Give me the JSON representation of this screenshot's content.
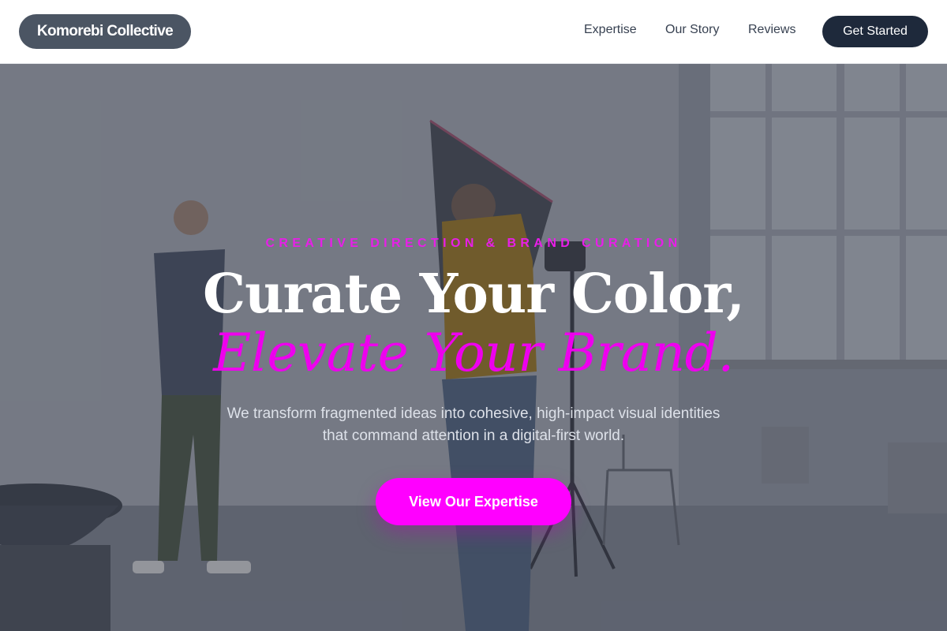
{
  "header": {
    "logo_text": "Komorebi Collective",
    "nav": [
      {
        "label": "Expertise"
      },
      {
        "label": "Our Story"
      },
      {
        "label": "Reviews"
      }
    ],
    "cta_label": "Get Started"
  },
  "hero": {
    "eyebrow": "CREATIVE DIRECTION & BRAND CURATION",
    "headline_line1": "Curate Your Color,",
    "headline_line2": "Elevate Your Brand.",
    "subcopy": "We transform fragmented ideas into cohesive, high-impact visual identities that command attention in a digital-first world.",
    "button_label": "View Our Expertise"
  },
  "colors": {
    "accent": "#ff00ff",
    "nav_button": "#1e293b",
    "logo_pill": "#4b5563"
  }
}
